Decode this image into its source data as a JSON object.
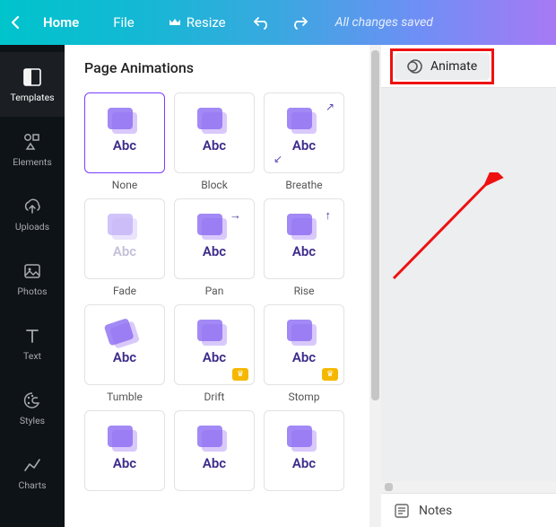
{
  "topbar": {
    "home": "Home",
    "file": "File",
    "resize": "Resize",
    "status": "All changes saved"
  },
  "sidebar": {
    "items": [
      {
        "label": "Templates"
      },
      {
        "label": "Elements"
      },
      {
        "label": "Uploads"
      },
      {
        "label": "Photos"
      },
      {
        "label": "Text"
      },
      {
        "label": "Styles"
      },
      {
        "label": "Charts"
      }
    ]
  },
  "panel": {
    "title": "Page Animations",
    "animations": [
      {
        "label": "None",
        "selected": true
      },
      {
        "label": "Block"
      },
      {
        "label": "Breathe"
      },
      {
        "label": "Fade"
      },
      {
        "label": "Pan"
      },
      {
        "label": "Rise"
      },
      {
        "label": "Tumble"
      },
      {
        "label": "Drift",
        "premium": true
      },
      {
        "label": "Stomp",
        "premium": true
      }
    ],
    "abc_text": "Abc"
  },
  "canvas": {
    "animate_label": "Animate",
    "notes_label": "Notes"
  }
}
